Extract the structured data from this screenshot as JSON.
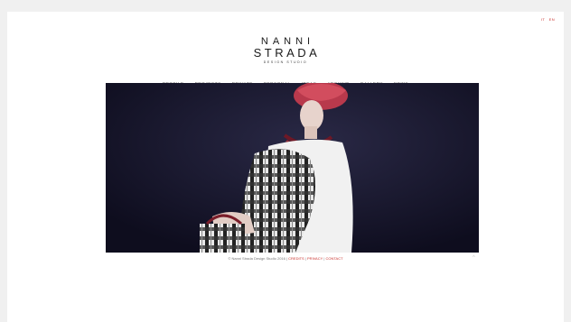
{
  "lang": {
    "it": "IT",
    "en": "EN"
  },
  "logo": {
    "line1": "NANNI",
    "line2": "STRADA",
    "line3": "DESIGN STUDIO"
  },
  "nav": [
    "PROFILE",
    "PROJECTS",
    "PRIVATE",
    "PERSONAL",
    "IDEAS",
    "ARCHIVE",
    "GALLERY",
    "NEWS"
  ],
  "footer": {
    "copyright": "© Nanni Strada Design Studio 2016 |",
    "credits": "CREDITS",
    "privacy": "PRIVACY",
    "contact": "CONTACT",
    "sep": "|"
  },
  "icons": {
    "back_to_top": "chevron-up-icon"
  },
  "colors": {
    "accent": "#c9302c",
    "hero_bg": "#15142a"
  }
}
